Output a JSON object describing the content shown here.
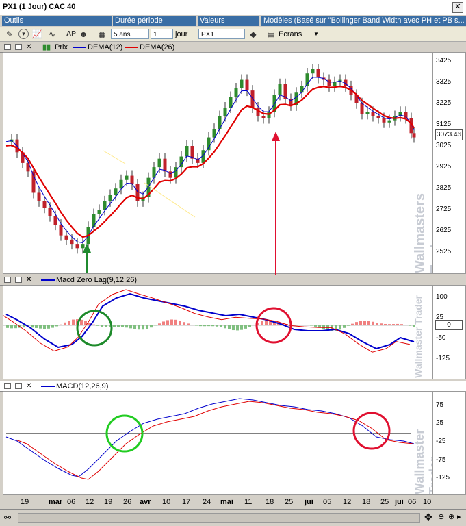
{
  "window": {
    "title": "PX1 (1 Jour) CAC 40",
    "close": "✕"
  },
  "tabs": [
    {
      "label": "Outils"
    },
    {
      "label": "Durée période"
    },
    {
      "label": "Valeurs"
    },
    {
      "label": "Modèles (Basé sur \"Bollinger Band Width avec PH et PB s..."
    }
  ],
  "toolbar": {
    "period_value": "5 ans",
    "step_value": "1",
    "step_unit": "jour",
    "symbol": "PX1",
    "screens_label": "Ecrans"
  },
  "price_panel": {
    "legend": [
      "Prix",
      "DEMA(12)",
      "DEMA(26)"
    ],
    "ticks": [
      "3425",
      "3325",
      "3225",
      "3125",
      "3025",
      "2925",
      "2825",
      "2725",
      "2625",
      "2525"
    ],
    "current_price": "3073.46",
    "watermark": "Wallmasters Trader"
  },
  "macd_zl_panel": {
    "legend": "Macd Zero Lag(9,12,26)",
    "ticks": [
      "100",
      "25",
      "-50",
      "-125"
    ],
    "zero_box": "0",
    "watermark": "Wallmaster Trader"
  },
  "macd_panel": {
    "legend": "MACD(12,26,9)",
    "ticks": [
      "75",
      "25",
      "-25",
      "-75",
      "-125"
    ],
    "watermark": "Wallmaster Trader"
  },
  "xaxis": {
    "labels": [
      "19",
      "mar",
      "06",
      "12",
      "19",
      "26",
      "avr",
      "10",
      "17",
      "24",
      "mai",
      "11",
      "18",
      "25",
      "jui",
      "05",
      "12",
      "18",
      "25",
      "jui",
      "06",
      "10"
    ]
  },
  "colors": {
    "dema12": "#0000cc",
    "dema26": "#e00000",
    "bull": "#2e8b2e",
    "bear": "#c0202a"
  }
}
